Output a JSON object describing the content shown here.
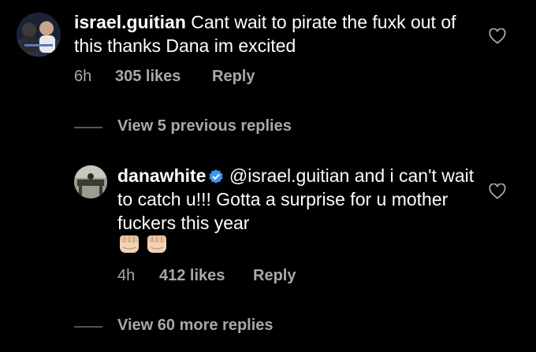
{
  "comment": {
    "username": "israel.guitian",
    "text": "Cant wait to pirate the fuxk out of this thanks Dana im excited",
    "time": "6h",
    "likes": "305 likes",
    "reply_label": "Reply",
    "avatar_icon": "user-avatar-photo",
    "like_icon": "heart-outline-icon"
  },
  "view_previous_replies": "View 5 previous replies",
  "reply": {
    "username": "danawhite",
    "verified_icon": "verified-badge-icon",
    "mention": "@israel.guitian",
    "text": "and i can't wait to catch u!!! Gotta a surprise for u mother fuckers this year",
    "emojis": [
      "fist-bump-emoji",
      "fist-bump-emoji"
    ],
    "time": "4h",
    "likes": "412 likes",
    "reply_label": "Reply",
    "avatar_icon": "user-avatar-photo",
    "like_icon": "heart-outline-icon"
  },
  "view_more_replies": "View 60 more replies",
  "colors": {
    "background": "#000000",
    "text_primary": "#ffffff",
    "text_secondary": "#a8a8a8",
    "verified_blue": "#3897f0",
    "divider": "#555555"
  }
}
